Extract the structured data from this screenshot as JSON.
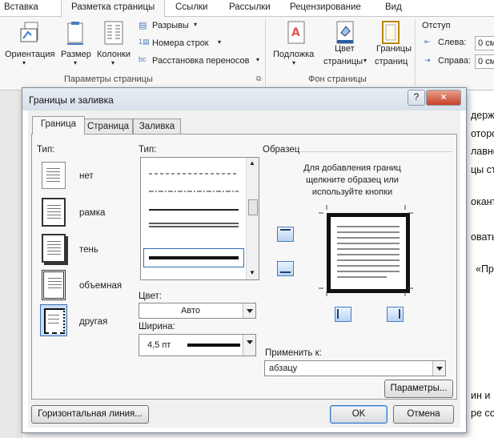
{
  "ribbon": {
    "tabs": [
      "Вставка",
      "Разметка страницы",
      "Ссылки",
      "Рассылки",
      "Рецензирование",
      "Вид"
    ],
    "page_setup": {
      "orientation": "Ориентация",
      "size": "Размер",
      "columns": "Колонки",
      "breaks": "Разрывы",
      "line_numbers": "Номера строк",
      "hyphenation": "Расстановка переносов",
      "group_label": "Параметры страницы"
    },
    "background": {
      "watermark": "Подложка",
      "page_color_1": "Цвет",
      "page_color_2": "страницы",
      "page_borders_1": "Границы",
      "page_borders_2": "страниц",
      "group_label": "Фон страницы"
    },
    "indent": {
      "title": "Отступ",
      "left_label": "Слева:",
      "left_value": "0 см",
      "right_label": "Справа:",
      "right_value": "0 см"
    }
  },
  "document": {
    "lines": [
      "держ",
      "оторо",
      "лавно",
      "цы ст",
      "оканте",
      "овать",
      "«Пр",
      "ин и",
      "ре со"
    ]
  },
  "dialog": {
    "title": "Границы и заливка",
    "help": "?",
    "close": "×",
    "tabs": [
      "Граница",
      "Страница",
      "Заливка"
    ],
    "type_label": "Тип:",
    "types": [
      "нет",
      "рамка",
      "тень",
      "объемная",
      "другая"
    ],
    "style_label": "Тип:",
    "color_label": "Цвет:",
    "color_value": "Авто",
    "width_label": "Ширина:",
    "width_value": "4,5 пт",
    "preview_label": "Образец",
    "preview_hint": [
      "Для добавления границ",
      "щелкните образец или",
      "используйте кнопки"
    ],
    "apply_label": "Применить к:",
    "apply_value": "абзацу",
    "options_button": "Параметры...",
    "horizontal_line_button": "Горизонтальная линия...",
    "ok_button": "OK",
    "cancel_button": "Отмена"
  }
}
